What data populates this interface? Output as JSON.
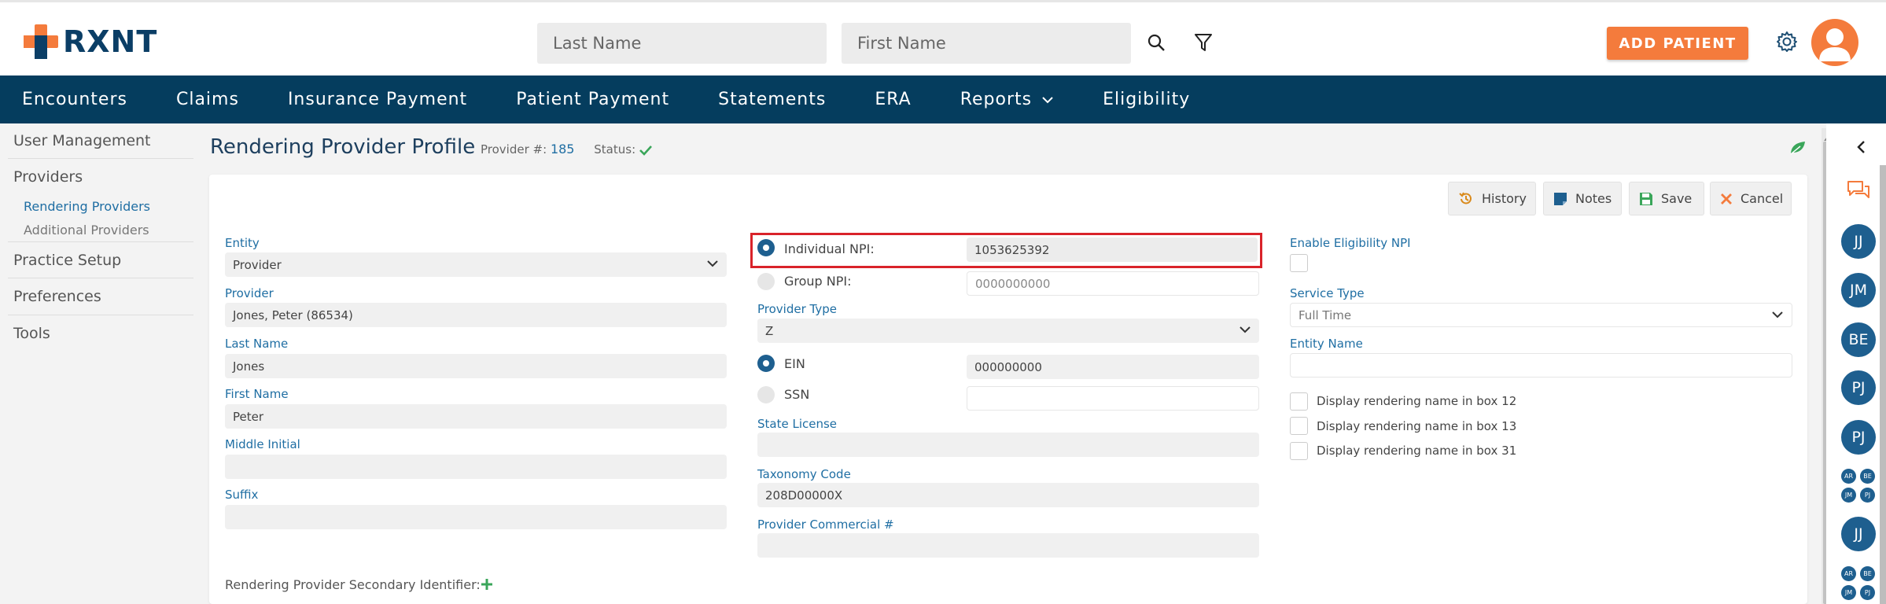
{
  "header": {
    "logo_text": "RXNT",
    "last_name_placeholder": "Last Name",
    "first_name_placeholder": "First Name",
    "add_patient_label": "ADD PATIENT"
  },
  "nav": {
    "items": [
      "Encounters",
      "Claims",
      "Insurance Payment",
      "Patient Payment",
      "Statements",
      "ERA",
      "Reports",
      "Eligibility"
    ]
  },
  "sidebar": {
    "user_management": "User Management",
    "providers": "Providers",
    "rendering_providers": "Rendering Providers",
    "additional_providers": "Additional Providers",
    "practice_setup": "Practice Setup",
    "preferences": "Preferences",
    "tools": "Tools"
  },
  "page": {
    "title": "Rendering Provider Profile",
    "provider_no_label": "Provider #:",
    "provider_no": "185",
    "status_label": "Status:"
  },
  "toolbar": {
    "history": "History",
    "notes": "Notes",
    "save": "Save",
    "cancel": "Cancel"
  },
  "form": {
    "entity_label": "Entity",
    "entity_value": "Provider",
    "provider_label": "Provider",
    "provider_value": "Jones, Peter  (86534)",
    "last_name_label": "Last Name",
    "last_name_value": "Jones",
    "first_name_label": "First Name",
    "first_name_value": "Peter",
    "middle_initial_label": "Middle Initial",
    "middle_initial_value": "",
    "suffix_label": "Suffix",
    "suffix_value": "",
    "individual_npi_label": "Individual NPI:",
    "individual_npi_value": "1053625392",
    "group_npi_label": "Group NPI:",
    "group_npi_placeholder": "0000000000",
    "provider_type_label": "Provider Type",
    "provider_type_value": "Z",
    "ein_label": "EIN",
    "ein_value": "000000000",
    "ssn_label": "SSN",
    "ssn_value": "",
    "state_license_label": "State License",
    "state_license_value": "",
    "taxonomy_label": "Taxonomy Code",
    "taxonomy_value": "208D00000X",
    "commercial_label": "Provider Commercial #",
    "commercial_value": "",
    "enable_eligibility_label": "Enable Eligibility NPI",
    "service_type_label": "Service Type",
    "service_type_value": "Full Time",
    "entity_name_label": "Entity Name",
    "entity_name_value": "",
    "box12_label": "Display rendering name in box 12",
    "box13_label": "Display rendering name in box 13",
    "box31_label": "Display rendering name in box 31",
    "secondary_id_label": "Rendering Provider Secondary Identifier:"
  },
  "rail": {
    "avatars": [
      "JJ",
      "JM",
      "BE",
      "PJ",
      "PJ",
      "JJ"
    ],
    "mini_group_1": [
      "AR",
      "BE",
      "JM",
      "PJ"
    ],
    "mini_group_2": [
      "AR",
      "BE",
      "JM",
      "PJ"
    ]
  },
  "colors": {
    "brand_navy": "#053d5e",
    "accent_orange": "#f47b3c",
    "link_blue": "#1f6ea3",
    "highlight_red": "#d9232a"
  }
}
